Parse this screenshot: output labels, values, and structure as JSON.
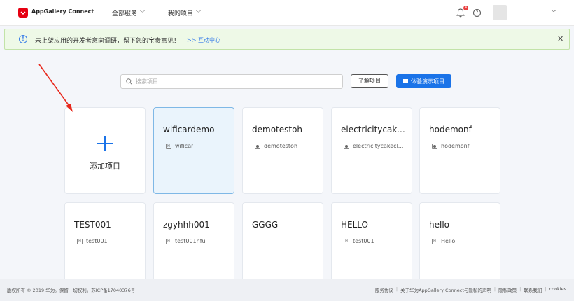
{
  "header": {
    "brand": "AppGallery Connect",
    "nav": [
      {
        "label": "全部服务"
      },
      {
        "label": "我的项目"
      }
    ],
    "notification_count": "4",
    "help_glyph": "?"
  },
  "notice": {
    "text": "未上架应用的开发者意向调研，留下您的宝贵意见！",
    "link": ">> 互动中心",
    "close_glyph": "✕"
  },
  "toolbar": {
    "search_placeholder": "搜索项目",
    "learn_label": "了解项目",
    "demo_label": "体验演示项目"
  },
  "add_card": {
    "label": "添加项目"
  },
  "projects": [
    {
      "title": "wificardemo",
      "app": "wificar",
      "app_icon": "H"
    },
    {
      "title": "demotestoh",
      "app": "demotestoh",
      "app_icon": "dot"
    },
    {
      "title": "electricitycake...",
      "app": "electricitycakecl...",
      "app_icon": "dot"
    },
    {
      "title": "hodemonf",
      "app": "hodemonf",
      "app_icon": "dot"
    },
    {
      "title": "TEST001",
      "app": "test001",
      "app_icon": "H"
    },
    {
      "title": "zgyhhh001",
      "app": "test001nfu",
      "app_icon": "H"
    },
    {
      "title": "GGGG",
      "app": "",
      "app_icon": ""
    },
    {
      "title": "HELLO",
      "app": "test001",
      "app_icon": "H"
    },
    {
      "title": "hello",
      "app": "Hello",
      "app_icon": "H"
    }
  ],
  "footer": {
    "copyright": "版权所有 © 2019 华为。保留一切权利。苏ICP备17040376号",
    "links": [
      "服务协议",
      "关于华为AppGallery Connect与隐私的声明",
      "隐私政策",
      "联系我们",
      "cookies"
    ]
  },
  "colors": {
    "accent": "#1a73e8",
    "brand_red": "#e60012",
    "annotation_arrow": "#e8281c",
    "notice_bg": "#eef9e7"
  }
}
